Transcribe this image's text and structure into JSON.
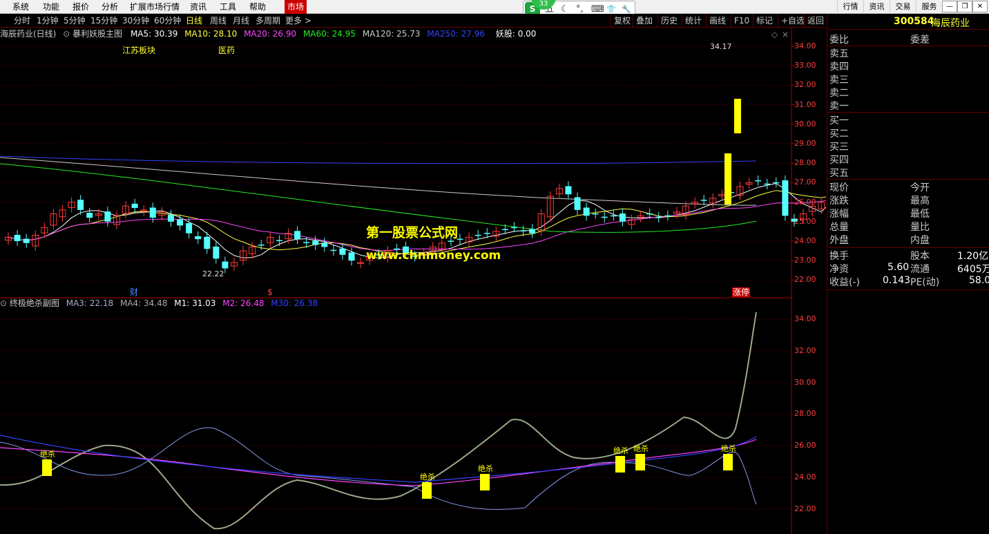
{
  "menu": {
    "items": [
      "系统",
      "功能",
      "报价",
      "分析",
      "扩展市场行情",
      "资讯",
      "工具",
      "帮助",
      "市场"
    ],
    "right": [
      "行情",
      "资讯",
      "交易",
      "服务"
    ]
  },
  "ime": {
    "glyphs": [
      "S",
      "五",
      "☾",
      "°,",
      "⌨",
      "👕",
      "🔧"
    ],
    "badge": "33"
  },
  "periods": {
    "items": [
      "分时",
      "1分钟",
      "5分钟",
      "15分钟",
      "30分钟",
      "60分钟",
      "日线",
      "周线",
      "月线",
      "多周期",
      "更多 >"
    ],
    "active": "日线"
  },
  "right_tools": [
    "复权",
    "叠加",
    "历史",
    "统计",
    "画线",
    "F10",
    "标记",
    "+自选",
    "返回"
  ],
  "main_header": {
    "title": "海辰药业(日线)",
    "formula": "暴利妖股主图",
    "ma": [
      {
        "label": "MA5: 30.39",
        "color": "#ffffff"
      },
      {
        "label": "MA10: 28.10",
        "color": "#ffff44"
      },
      {
        "label": "MA20: 26.90",
        "color": "#ff44ff"
      },
      {
        "label": "MA60: 24.95",
        "color": "#22ee22"
      },
      {
        "label": "MA120: 25.73",
        "color": "#cccccc"
      },
      {
        "label": "MA250: 27.96",
        "color": "#3344ff"
      },
      {
        "label": "妖股: 0.00",
        "color": "#ffffff"
      }
    ]
  },
  "tags": {
    "sector": "江苏板块",
    "industry": "医药",
    "cai": "财",
    "dollar": "$",
    "zhangting": "涨停"
  },
  "price_axis": [
    "34.00",
    "33.00",
    "32.00",
    "31.00",
    "30.00",
    "29.00",
    "28.00",
    "27.00",
    "26.00",
    "25.00",
    "24.00",
    "23.00",
    "22.00"
  ],
  "price_labels": {
    "high": "34.17",
    "low": "22.22"
  },
  "watermark": {
    "line1": "第一股票公式网",
    "line2": "www.chnmoney.com"
  },
  "sub_header": {
    "title": "终极绝杀副图",
    "items": [
      {
        "label": "MA3: 22.18",
        "color": "#aaaacc"
      },
      {
        "label": "MA4: 34.48",
        "color": "#aaaaaa"
      },
      {
        "label": "M1: 31.03",
        "color": "#ffffff"
      },
      {
        "label": "M2: 26.48",
        "color": "#ff44ff"
      },
      {
        "label": "M30: 26.38",
        "color": "#3344ff"
      }
    ]
  },
  "sub_axis": [
    "34.00",
    "32.00",
    "30.00",
    "28.00",
    "26.00",
    "24.00",
    "22.00"
  ],
  "signal_label": "绝杀",
  "quote": {
    "code": "300584",
    "name": "海辰药业",
    "weibi": "委比",
    "weicha": "委差",
    "sells": [
      "卖五",
      "卖四",
      "卖三",
      "卖二",
      "卖一"
    ],
    "buys": [
      "买一",
      "买二",
      "买三",
      "买四",
      "买五"
    ],
    "stats_left": [
      "现价",
      "涨跌",
      "涨幅",
      "总量",
      "外盘"
    ],
    "stats_right": [
      "今开",
      "最高",
      "最低",
      "量比",
      "内盘"
    ],
    "extra": [
      [
        "换手",
        "",
        "股本",
        "1.20亿"
      ],
      [
        "净资",
        "5.60",
        "流通",
        "6405万"
      ],
      [
        "收益(-)",
        "0.143",
        "PE(动)",
        "58.0"
      ]
    ]
  },
  "colors": {
    "up": "#ff3c3c",
    "down": "#54ffff",
    "grid": "#7a0000",
    "yellow": "#ffff00"
  }
}
